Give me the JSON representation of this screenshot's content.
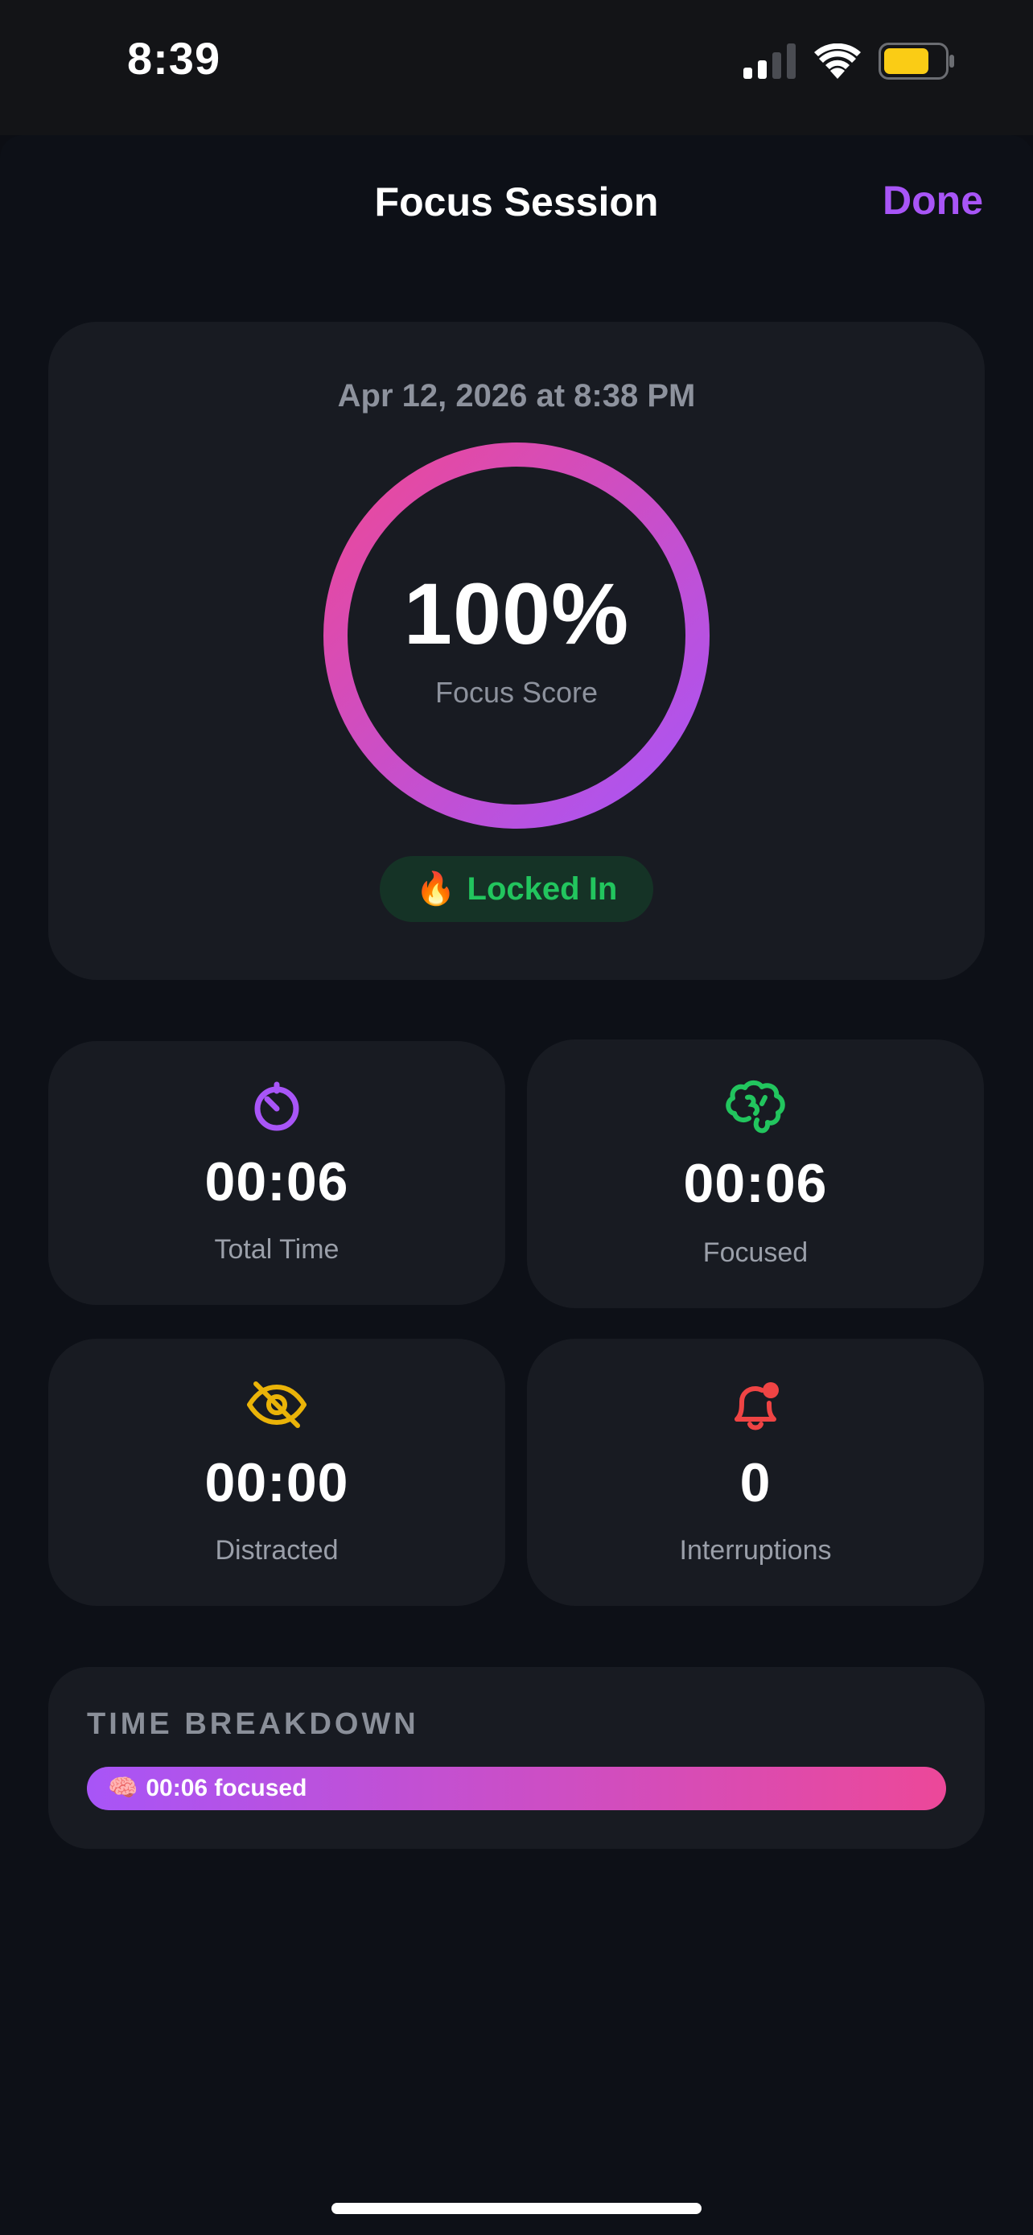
{
  "status_bar": {
    "time": "8:39",
    "signal_bars_active": 2,
    "signal_bars_total": 4,
    "battery_level": 0.75,
    "battery_color": "#facc15"
  },
  "nav": {
    "title": "Focus Session",
    "done_label": "Done",
    "accent": "#a855f7"
  },
  "score_card": {
    "date": "Apr 12, 2026 at 8:38 PM",
    "score_value": "100%",
    "score_fraction": 1.0,
    "score_label": "Focus Score",
    "ring_gradient": [
      "#ec4899",
      "#a855f7"
    ],
    "badge": {
      "icon": "fire-icon",
      "emoji": "🔥",
      "label": "Locked In",
      "color": "#22c55e"
    }
  },
  "stats": [
    {
      "icon": "timer-icon",
      "value": "00:06",
      "label": "Total Time",
      "color": "#a855f7"
    },
    {
      "icon": "brain-icon",
      "value": "00:06",
      "label": "Focused",
      "color": "#22c55e"
    },
    {
      "icon": "eye-slash-icon",
      "value": "00:00",
      "label": "Distracted",
      "color": "#eab308"
    },
    {
      "icon": "bell-alert-icon",
      "value": "0",
      "label": "Interruptions",
      "color": "#ef4444"
    }
  ],
  "breakdown": {
    "title": "TIME BREAKDOWN",
    "bar_icon": "brain-icon",
    "bar_emoji": "🧠",
    "bar_text": "00:06 focused",
    "focused_fraction": 1.0,
    "gradient": [
      "#a855f7",
      "#ec4899"
    ]
  }
}
